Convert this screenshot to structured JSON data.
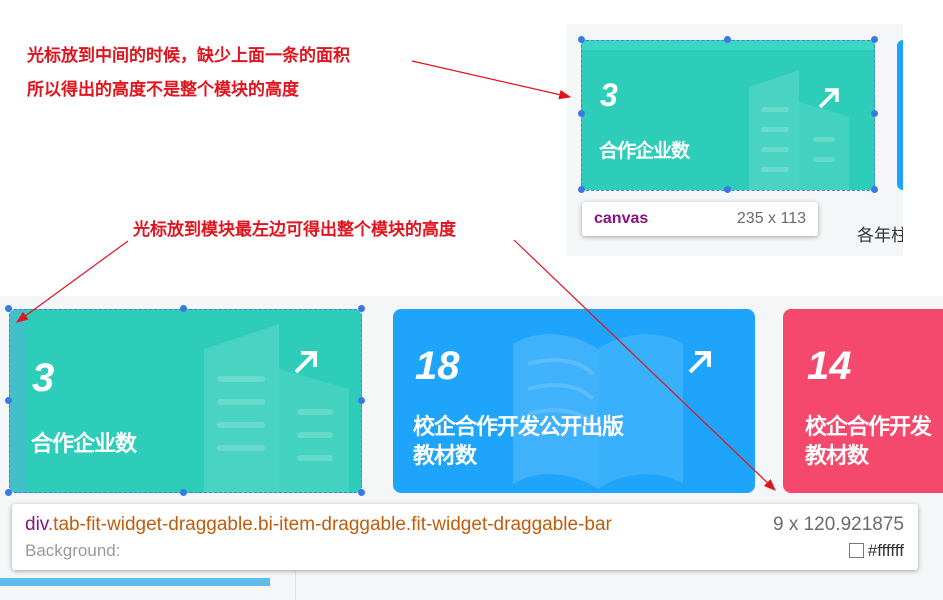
{
  "annotations": {
    "note1_line1": "光标放到中间的时候，缺少上面一条的面积",
    "note1_line2": "所以得出的高度不是整个模块的高度",
    "note2": "光标放到模块最左边可得出整个模块的高度"
  },
  "colors": {
    "annotation": "#e0141e",
    "teal_card": "#2ecdb9",
    "blue_card": "#1ea5fb",
    "pink_card": "#f4496c",
    "selection": "#3b78e7"
  },
  "top_screenshot": {
    "card": {
      "value": "3",
      "label": "合作企业数",
      "icon": "arrow-up-right-icon"
    },
    "tooltip": {
      "tag": "canvas",
      "size": "235 x 113"
    },
    "side_text": "各年柱"
  },
  "bottom_screenshot": {
    "cards": [
      {
        "value": "3",
        "label_line1": "合作企业数",
        "label_line2": "",
        "icon": "arrow-up-right-icon"
      },
      {
        "value": "18",
        "label_line1": "校企合作开发公开出版",
        "label_line2": "教材数",
        "icon": "arrow-up-right-icon"
      },
      {
        "value": "14",
        "label_line1": "校企合作开发",
        "label_line2": "教材数",
        "icon": "arrow-up-right-icon"
      }
    ],
    "tooltip": {
      "tag": "div",
      "classes": ".tab-fit-widget-draggable.bi-item-draggable.fit-widget-draggable-bar",
      "size": "9 x 120.921875",
      "bg_label": "Background:",
      "bg_value": "#ffffff"
    }
  }
}
